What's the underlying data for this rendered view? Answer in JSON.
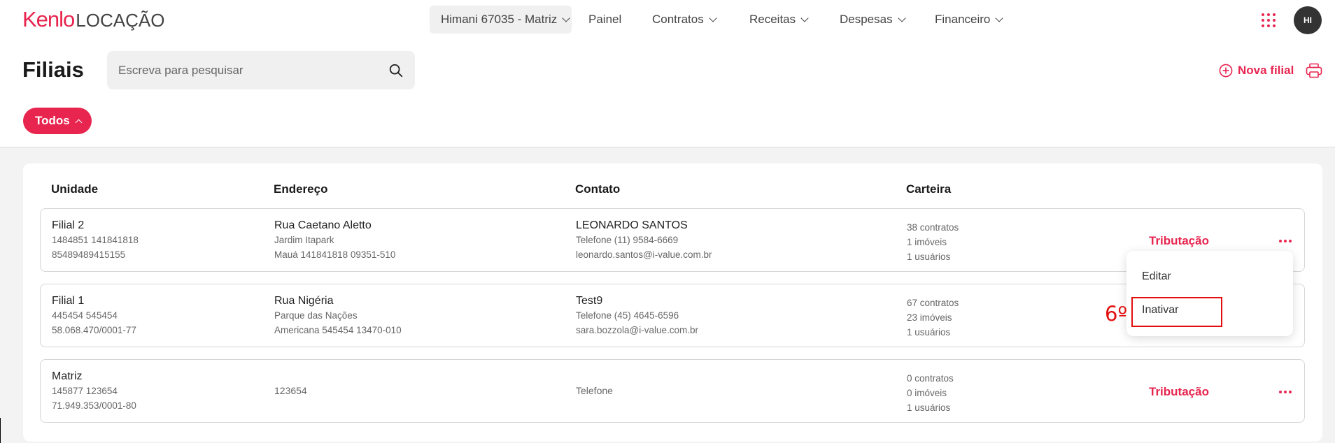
{
  "header": {
    "logo_brand": "Kenlo",
    "logo_product": "LOCAÇÃO",
    "branch_selector": "Himani 67035 - Matriz",
    "nav": [
      "Painel",
      "Contratos",
      "Receitas",
      "Despesas",
      "Financeiro"
    ],
    "avatar_initials": "HI"
  },
  "page": {
    "title": "Filiais",
    "search_placeholder": "Escreva para pesquisar",
    "new_button": "Nova filial",
    "filter_chip": "Todos"
  },
  "table": {
    "columns": [
      "Unidade",
      "Endereço",
      "Contato",
      "Carteira"
    ],
    "rows": [
      {
        "unit_name": "Filial 2",
        "unit_line1": "1484851 141841818",
        "unit_line2": "85489489415155",
        "address_street": "Rua Caetano Aletto",
        "address_line1": "Jardim Itapark",
        "address_line2": "Mauá 141841818 09351-510",
        "contact_name": "LEONARDO SANTOS",
        "contact_phone": "Telefone (11) 9584-6669",
        "contact_email": "leonardo.santos@i-value.com.br",
        "wallet_contracts": "38 contratos",
        "wallet_properties": "1 imóveis",
        "wallet_users": "1 usuários",
        "tax_link": "Tributação"
      },
      {
        "unit_name": "Filial 1",
        "unit_line1": "445454 545454",
        "unit_line2": "58.068.470/0001-77",
        "address_street": "Rua Nigéria",
        "address_line1": "Parque das Nações",
        "address_line2": "Americana 545454 13470-010",
        "contact_name": "Test9",
        "contact_phone": "Telefone (45) 4645-6596",
        "contact_email": "sara.bozzola@i-value.com.br",
        "wallet_contracts": "67 contratos",
        "wallet_properties": "23 imóveis",
        "wallet_users": "1 usuários"
      },
      {
        "unit_name": "Matriz",
        "unit_line1": "145877 123654",
        "unit_line2": "71.949.353/0001-80",
        "address_single": "123654",
        "contact_single": "Telefone",
        "wallet_contracts": "0 contratos",
        "wallet_properties": "0 imóveis",
        "wallet_users": "1 usuários",
        "tax_link": "Tributação"
      }
    ]
  },
  "row_menu": {
    "items": [
      "Editar",
      "Inativar"
    ]
  },
  "annotation": {
    "label": "6º",
    "color": "#e30f0f"
  },
  "colors": {
    "accent": "#e8254f"
  }
}
